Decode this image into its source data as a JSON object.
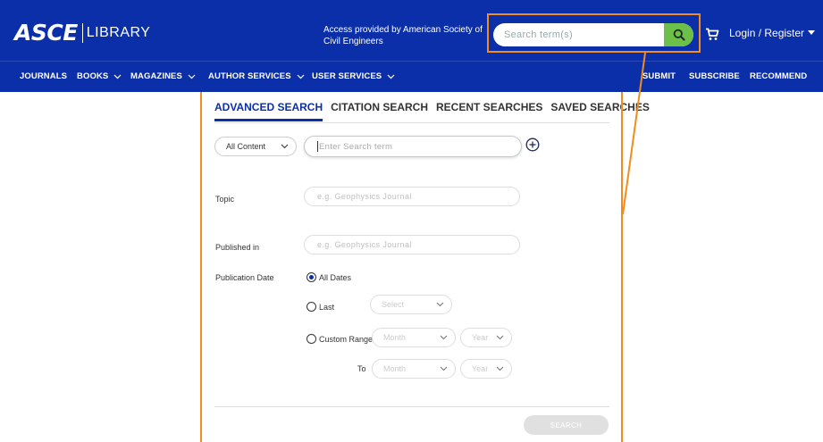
{
  "header": {
    "logo_brand": "ASCE",
    "logo_sub": "LIBRARY",
    "access_text": "Access provided by American Society of Civil Engineers",
    "search_placeholder": "Search term(s)",
    "login_label": "Login / Register"
  },
  "nav": {
    "journals": "JOURNALS",
    "books": "BOOKS",
    "magazines": "MAGAZINES",
    "author_services": "AUTHOR SERVICES",
    "user_services": "USER SERVICES",
    "submit": "SUBMIT",
    "subscribe": "SUBSCRIBE",
    "recommend": "RECOMMEND"
  },
  "tabs": {
    "advanced": "ADVANCED SEARCH",
    "citation": "CITATION SEARCH",
    "recent": "RECENT SEARCHES",
    "saved": "SAVED SEARCHES"
  },
  "form": {
    "content_select": "All Content",
    "term_placeholder": "Enter Search term",
    "topic_label": "Topic",
    "topic_placeholder": "e.g. Geophysics Journal",
    "published_label": "Published in",
    "published_placeholder": "e.g. Geophysics Journal",
    "pubdate_label": "Publication Date",
    "all_dates": "All Dates",
    "last": "Last",
    "last_select": "Select",
    "custom_range": "Custom Range",
    "month": "Month",
    "year": "Year",
    "to": "To",
    "search_button": "SEARCH"
  },
  "colors": {
    "brand_blue": "#0b2fa8",
    "search_green": "#6cc04a",
    "highlight_orange": "#f28c1e"
  }
}
